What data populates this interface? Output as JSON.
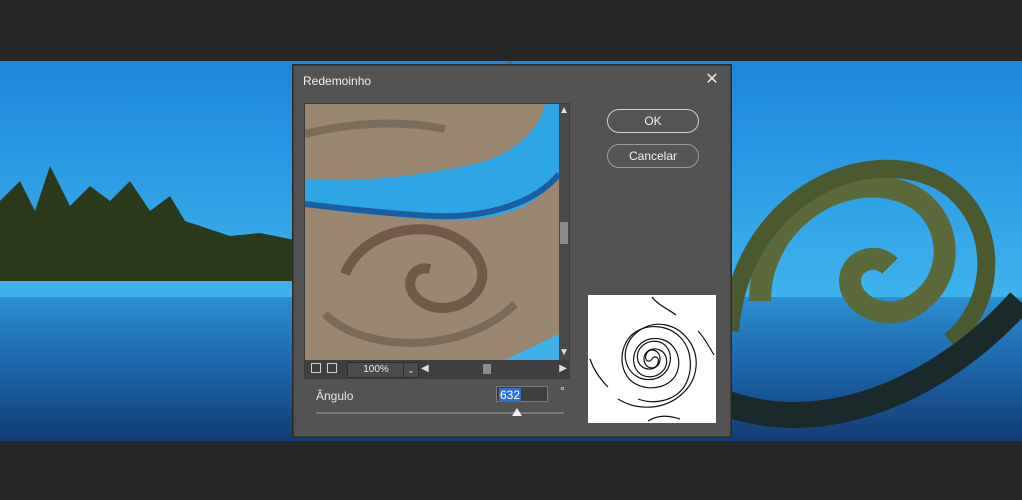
{
  "dialog": {
    "title": "Redemoinho",
    "close_icon": "close-icon"
  },
  "buttons": {
    "ok": "OK",
    "cancel": "Cancelar"
  },
  "preview": {
    "zoom": "100%",
    "zoom_out_icon": "minus-icon",
    "zoom_in_icon": "plus-icon",
    "scroll_up_icon": "triangle-up-icon",
    "scroll_down_icon": "triangle-down-icon",
    "scroll_left_icon": "triangle-left-icon",
    "scroll_right_icon": "triangle-right-icon"
  },
  "angle": {
    "label": "Ângulo",
    "value": "632",
    "unit": "°",
    "slider_fraction": 0.81
  },
  "colors": {
    "dialog_bg": "#535353",
    "selection": "#2f6fd2"
  }
}
